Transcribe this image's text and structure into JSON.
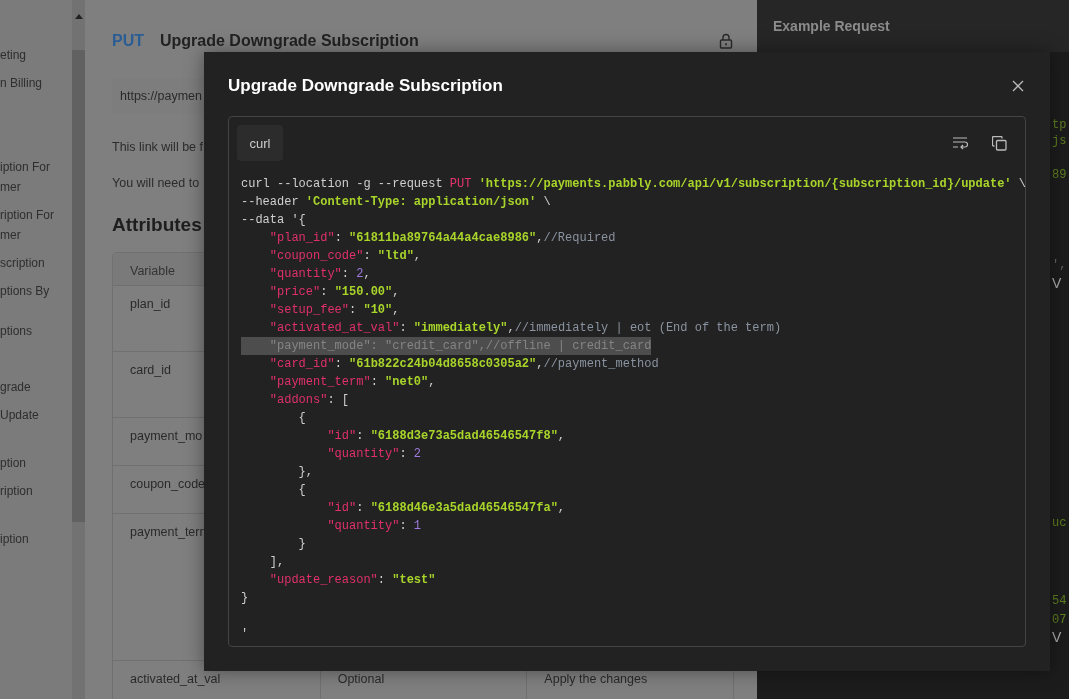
{
  "sidebar": {
    "items": [
      {
        "text": "eting"
      },
      {
        "text": "n Billing"
      },
      {
        "text": "iption For\nmer"
      },
      {
        "text": "ription For\nmer"
      },
      {
        "text": "scription"
      },
      {
        "text": "ptions By"
      },
      {
        "text": "ptions"
      },
      {
        "text": "grade"
      },
      {
        "text": "Update"
      },
      {
        "text": "ption"
      },
      {
        "text": "ription"
      },
      {
        "text": "iption"
      }
    ]
  },
  "main": {
    "method": "PUT",
    "title": "Upgrade Downgrade Subscription",
    "url": "https://paymen",
    "paragraphs": [
      "This link will be f",
      "You will need to"
    ],
    "section_title": "Attributes",
    "table": {
      "rows": [
        {
          "cells": [
            "Variable"
          ]
        },
        {
          "cells": [
            "plan_id"
          ]
        },
        {
          "cells": [
            "card_id"
          ]
        },
        {
          "cells": [
            "payment_mo"
          ]
        },
        {
          "cells": [
            "coupon_code"
          ]
        },
        {
          "cells": [
            "payment_tern"
          ]
        },
        {
          "cells": [
            "activated_at_val",
            "Optional",
            "Apply the changes"
          ]
        }
      ]
    }
  },
  "example_panel": {
    "title": "Example Request",
    "fragments": [
      {
        "text": "tp",
        "kind": "string"
      },
      {
        "text": "js",
        "kind": "string"
      },
      {
        "text": "89",
        "kind": "string"
      },
      {
        "text": "',",
        "kind": "comment"
      },
      {
        "text": "V",
        "kind": "label"
      },
      {
        "text": "uc",
        "kind": "string"
      },
      {
        "text": "54",
        "kind": "string"
      },
      {
        "text": "07",
        "kind": "string"
      },
      {
        "text": "V",
        "kind": "label"
      }
    ]
  },
  "modal": {
    "title": "Upgrade Downgrade Subscription",
    "tab": "curl",
    "code_lines": [
      {
        "highlighted": false,
        "tokens": [
          {
            "kind": "plain",
            "text": "curl --location -g --request "
          },
          {
            "kind": "keyword",
            "text": "PUT"
          },
          {
            "kind": "string",
            "text": " 'https://payments.pabbly.com/api/v1/subscription/{subscription_id}/update'"
          },
          {
            "kind": "plain",
            "text": " \\"
          }
        ]
      },
      {
        "highlighted": false,
        "tokens": [
          {
            "kind": "plain",
            "text": "--header "
          },
          {
            "kind": "string",
            "text": "'Content-Type: application/json'"
          },
          {
            "kind": "plain",
            "text": " \\"
          }
        ]
      },
      {
        "highlighted": false,
        "tokens": [
          {
            "kind": "plain",
            "text": "--data '{"
          }
        ]
      },
      {
        "highlighted": false,
        "tokens": [
          {
            "kind": "key",
            "text": "    \"plan_id\""
          },
          {
            "kind": "plain",
            "text": ": "
          },
          {
            "kind": "string",
            "text": "\"61811ba89764a44a4cae8986\""
          },
          {
            "kind": "plain",
            "text": ","
          },
          {
            "kind": "comment",
            "text": "//Required"
          }
        ]
      },
      {
        "highlighted": false,
        "tokens": [
          {
            "kind": "key",
            "text": "    \"coupon_code\""
          },
          {
            "kind": "plain",
            "text": ": "
          },
          {
            "kind": "string",
            "text": "\"ltd\""
          },
          {
            "kind": "plain",
            "text": ","
          }
        ]
      },
      {
        "highlighted": false,
        "tokens": [
          {
            "kind": "key",
            "text": "    \"quantity\""
          },
          {
            "kind": "plain",
            "text": ": "
          },
          {
            "kind": "number",
            "text": "2"
          },
          {
            "kind": "plain",
            "text": ","
          }
        ]
      },
      {
        "highlighted": false,
        "tokens": [
          {
            "kind": "key",
            "text": "    \"price\""
          },
          {
            "kind": "plain",
            "text": ": "
          },
          {
            "kind": "string",
            "text": "\"150.00\""
          },
          {
            "kind": "plain",
            "text": ","
          }
        ]
      },
      {
        "highlighted": false,
        "tokens": [
          {
            "kind": "key",
            "text": "    \"setup_fee\""
          },
          {
            "kind": "plain",
            "text": ": "
          },
          {
            "kind": "string",
            "text": "\"10\""
          },
          {
            "kind": "plain",
            "text": ","
          }
        ]
      },
      {
        "highlighted": false,
        "tokens": [
          {
            "kind": "key",
            "text": "    \"activated_at_val\""
          },
          {
            "kind": "plain",
            "text": ": "
          },
          {
            "kind": "string",
            "text": "\"immediately\""
          },
          {
            "kind": "plain",
            "text": ","
          },
          {
            "kind": "comment",
            "text": "//immediately | eot (End of the term)"
          }
        ]
      },
      {
        "highlighted": true,
        "tokens": [
          {
            "kind": "dimmed",
            "text": "    \"payment_mode\": \"credit_card\",//offline | credit_card"
          }
        ]
      },
      {
        "highlighted": false,
        "tokens": [
          {
            "kind": "key",
            "text": "    \"card_id\""
          },
          {
            "kind": "plain",
            "text": ": "
          },
          {
            "kind": "string",
            "text": "\"61b822c24b04d8658c0305a2\""
          },
          {
            "kind": "plain",
            "text": ","
          },
          {
            "kind": "comment",
            "text": "//payment_method"
          }
        ]
      },
      {
        "highlighted": false,
        "tokens": [
          {
            "kind": "key",
            "text": "    \"payment_term\""
          },
          {
            "kind": "plain",
            "text": ": "
          },
          {
            "kind": "string",
            "text": "\"net0\""
          },
          {
            "kind": "plain",
            "text": ","
          }
        ]
      },
      {
        "highlighted": false,
        "tokens": [
          {
            "kind": "key",
            "text": "    \"addons\""
          },
          {
            "kind": "plain",
            "text": ": ["
          }
        ]
      },
      {
        "highlighted": false,
        "tokens": [
          {
            "kind": "plain",
            "text": "        {"
          }
        ]
      },
      {
        "highlighted": false,
        "tokens": [
          {
            "kind": "key",
            "text": "            \"id\""
          },
          {
            "kind": "plain",
            "text": ": "
          },
          {
            "kind": "string",
            "text": "\"6188d3e73a5dad46546547f8\""
          },
          {
            "kind": "plain",
            "text": ","
          }
        ]
      },
      {
        "highlighted": false,
        "tokens": [
          {
            "kind": "key",
            "text": "            \"quantity\""
          },
          {
            "kind": "plain",
            "text": ": "
          },
          {
            "kind": "number",
            "text": "2"
          }
        ]
      },
      {
        "highlighted": false,
        "tokens": [
          {
            "kind": "plain",
            "text": "        },"
          }
        ]
      },
      {
        "highlighted": false,
        "tokens": [
          {
            "kind": "plain",
            "text": "        {"
          }
        ]
      },
      {
        "highlighted": false,
        "tokens": [
          {
            "kind": "key",
            "text": "            \"id\""
          },
          {
            "kind": "plain",
            "text": ": "
          },
          {
            "kind": "string",
            "text": "\"6188d46e3a5dad46546547fa\""
          },
          {
            "kind": "plain",
            "text": ","
          }
        ]
      },
      {
        "highlighted": false,
        "tokens": [
          {
            "kind": "key",
            "text": "            \"quantity\""
          },
          {
            "kind": "plain",
            "text": ": "
          },
          {
            "kind": "number",
            "text": "1"
          }
        ]
      },
      {
        "highlighted": false,
        "tokens": [
          {
            "kind": "plain",
            "text": "        }"
          }
        ]
      },
      {
        "highlighted": false,
        "tokens": [
          {
            "kind": "plain",
            "text": "    ],"
          }
        ]
      },
      {
        "highlighted": false,
        "tokens": [
          {
            "kind": "key",
            "text": "    \"update_reason\""
          },
          {
            "kind": "plain",
            "text": ": "
          },
          {
            "kind": "string",
            "text": "\"test\""
          }
        ]
      },
      {
        "highlighted": false,
        "tokens": [
          {
            "kind": "plain",
            "text": "}"
          }
        ]
      },
      {
        "highlighted": false,
        "tokens": [
          {
            "kind": "plain",
            "text": "'"
          }
        ]
      }
    ]
  }
}
